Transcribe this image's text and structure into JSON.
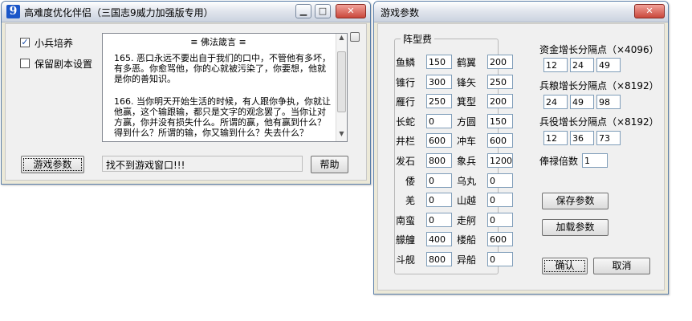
{
  "left_window": {
    "icon_text": "9",
    "title": "高难度优化伴侣（三国志9威力加强版专用）",
    "checkbox_soldier": {
      "label": "小兵培养",
      "checked": true,
      "mark": "✓"
    },
    "checkbox_keep": {
      "label": "保留剧本设置",
      "checked": false
    },
    "text_title": "≡  佛法箴言  ≡",
    "paragraph_1": "165. 恶口永远不要出自于我们的口中，不管他有多坏，有多恶。你愈骂他，你的心就被污染了，你要想，他就是你的善知识。",
    "paragraph_2": "166. 当你明天开始生活的时候，有人跟你争执，你就让他赢，这个输跟输，都只是文字的观念罢了。当你让对方赢，你并没有损失什么。所谓的赢，他有赢到什么？得到什么？所谓的输，你又输到什么？失去什么？",
    "game_params_button": "游戏参数",
    "status": "找不到游戏窗口!!!",
    "help_button": "帮助"
  },
  "right_window": {
    "title": "游戏参数",
    "group_title": "阵型费",
    "formations": [
      {
        "name": "鱼鳞",
        "value": "150"
      },
      {
        "name": "锥行",
        "value": "300"
      },
      {
        "name": "雁行",
        "value": "250"
      },
      {
        "name": "长蛇",
        "value": "0"
      },
      {
        "name": "井栏",
        "value": "600"
      },
      {
        "name": "发石",
        "value": "800"
      },
      {
        "name": "倭",
        "value": "0"
      },
      {
        "name": "羌",
        "value": "0"
      },
      {
        "name": "南蛮",
        "value": "0"
      },
      {
        "name": "艨艟",
        "value": "400"
      },
      {
        "name": "斗舰",
        "value": "800"
      },
      {
        "name": "鹤翼",
        "value": "200"
      },
      {
        "name": "锋矢",
        "value": "250"
      },
      {
        "name": "箕型",
        "value": "200"
      },
      {
        "name": "方圆",
        "value": "150"
      },
      {
        "name": "冲车",
        "value": "600"
      },
      {
        "name": "象兵",
        "value": "1200"
      },
      {
        "name": "乌丸",
        "value": "0"
      },
      {
        "name": "山越",
        "value": "0"
      },
      {
        "name": "走舸",
        "value": "0"
      },
      {
        "name": "楼船",
        "value": "600"
      },
      {
        "name": "异船",
        "value": "0"
      }
    ],
    "funds_growth": {
      "label": "资金增长分隔点（×4096）",
      "values": [
        "12",
        "24",
        "49"
      ]
    },
    "food_growth": {
      "label": "兵粮增长分隔点（×8192）",
      "values": [
        "24",
        "49",
        "98"
      ]
    },
    "service_growth": {
      "label": "兵役增长分隔点（×8192）",
      "values": [
        "12",
        "36",
        "73"
      ]
    },
    "salary_multiplier": {
      "label": "俸禄倍数",
      "value": "1"
    },
    "save_button": "保存参数",
    "load_button": "加载参数",
    "ok_button": "确认",
    "cancel_button": "取消"
  },
  "colors": {
    "title_icon_bg": "#1a56c9",
    "close_button": "#c9473b",
    "window_bg": "#f0f0f0"
  }
}
